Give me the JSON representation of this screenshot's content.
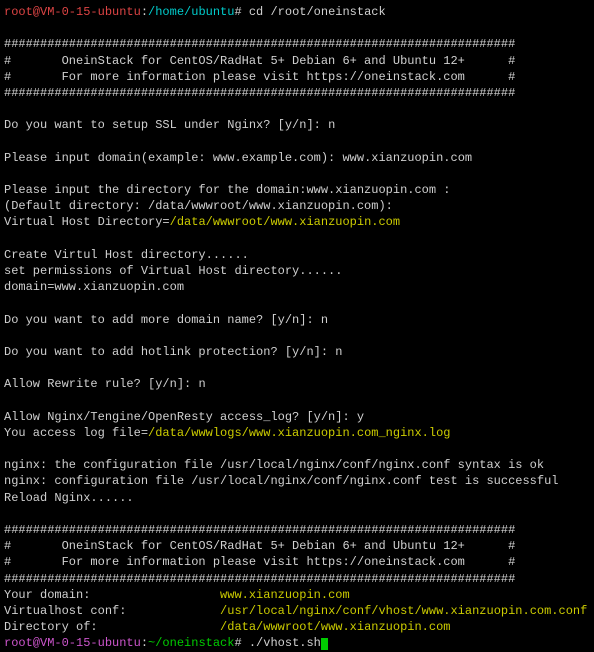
{
  "prompt1": {
    "user_host": "root@VM-0-15-ubuntu",
    "sep1": ":",
    "path": "/home/ubuntu",
    "sep2": "# ",
    "cmd": "cd /root/oneinstack"
  },
  "banner": {
    "hr": "#######################################################################",
    "line1": "#       OneinStack for CentOS/RadHat 5+ Debian 6+ and Ubuntu 12+      #",
    "line2": "#       For more information please visit https://oneinstack.com      #"
  },
  "ssl": {
    "question": "Do you want to setup SSL under Nginx? [y/n]: ",
    "answer": "n"
  },
  "domain_input": {
    "question": "Please input domain(example: www.example.com): ",
    "answer": "www.xianzuopin.com"
  },
  "dir_prompt": {
    "line1": "Please input the directory for the domain:www.xianzuopin.com :",
    "line2": "(Default directory: /data/wwwroot/www.xianzuopin.com):",
    "label": "Virtual Host Directory=",
    "value": "/data/wwwroot/www.xianzuopin.com"
  },
  "create": {
    "line1": "Create Virtul Host directory......",
    "line2": "set permissions of Virtual Host directory......",
    "line3": "domain=www.xianzuopin.com"
  },
  "more_domain": {
    "question": "Do you want to add more domain name? [y/n]: ",
    "answer": "n"
  },
  "hotlink": {
    "question": "Do you want to add hotlink protection? [y/n]: ",
    "answer": "n"
  },
  "rewrite": {
    "question": "Allow Rewrite rule? [y/n]: ",
    "answer": "n"
  },
  "access_log": {
    "question": "Allow Nginx/Tengine/OpenResty access_log? [y/n]: ",
    "answer": "y",
    "label": "You access log file=",
    "value": "/data/wwwlogs/www.xianzuopin.com_nginx.log"
  },
  "nginx": {
    "line1": "nginx: the configuration file /usr/local/nginx/conf/nginx.conf syntax is ok",
    "line2": "nginx: configuration file /usr/local/nginx/conf/nginx.conf test is successful",
    "line3": "Reload Nginx......"
  },
  "summary": {
    "hr": "#######################################################################",
    "domain_label": "Your domain:                  ",
    "domain_value": "www.xianzuopin.com",
    "vhost_label": "Virtualhost conf:             ",
    "vhost_value": "/usr/local/nginx/conf/vhost/www.xianzuopin.com.conf",
    "dir_label": "Directory of:                 ",
    "dir_value": "/data/wwwroot/www.xianzuopin.com"
  },
  "prompt2": {
    "user_host": "root@VM-0-15-ubuntu",
    "sep1": ":",
    "path": "~/oneinstack",
    "sep2": "# ",
    "cmd": "./vhost.sh"
  }
}
